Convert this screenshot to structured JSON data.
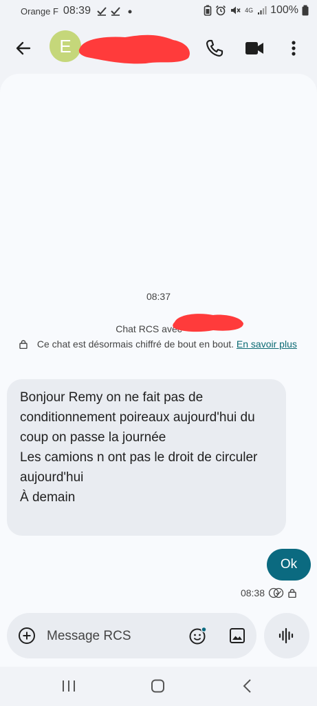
{
  "status_bar": {
    "carrier": "Orange F",
    "time": "08:39",
    "network": "4G",
    "battery": "100%"
  },
  "app_bar": {
    "avatar_letter": "E",
    "contact_name": "",
    "icons": [
      "back-arrow-icon",
      "phone-icon",
      "video-icon",
      "more-vert-icon"
    ]
  },
  "conversation": {
    "date_label": "08:37",
    "rcs_title": "Chat RCS avec ",
    "encryption_notice": "Ce chat est désormais chiffré de bout en bout.",
    "learn_more": "En savoir plus",
    "messages": [
      {
        "direction": "incoming",
        "lines": [
          "Bonjour Remy on ne fait pas de",
          "conditionnement poireaux aujourd'hui du",
          "coup on passe la journée",
          "Les camions n ont pas le droit de circuler",
          "aujourd'hui",
          "À demain"
        ]
      },
      {
        "direction": "outgoing",
        "text": "Ok",
        "time": "08:38"
      }
    ]
  },
  "composer": {
    "placeholder": "Message RCS"
  },
  "colors": {
    "accent": "#0b6a80",
    "avatar": "#c5d77a",
    "redaction": "#ff3b3b",
    "incoming_bubble": "#e9ecf1"
  }
}
